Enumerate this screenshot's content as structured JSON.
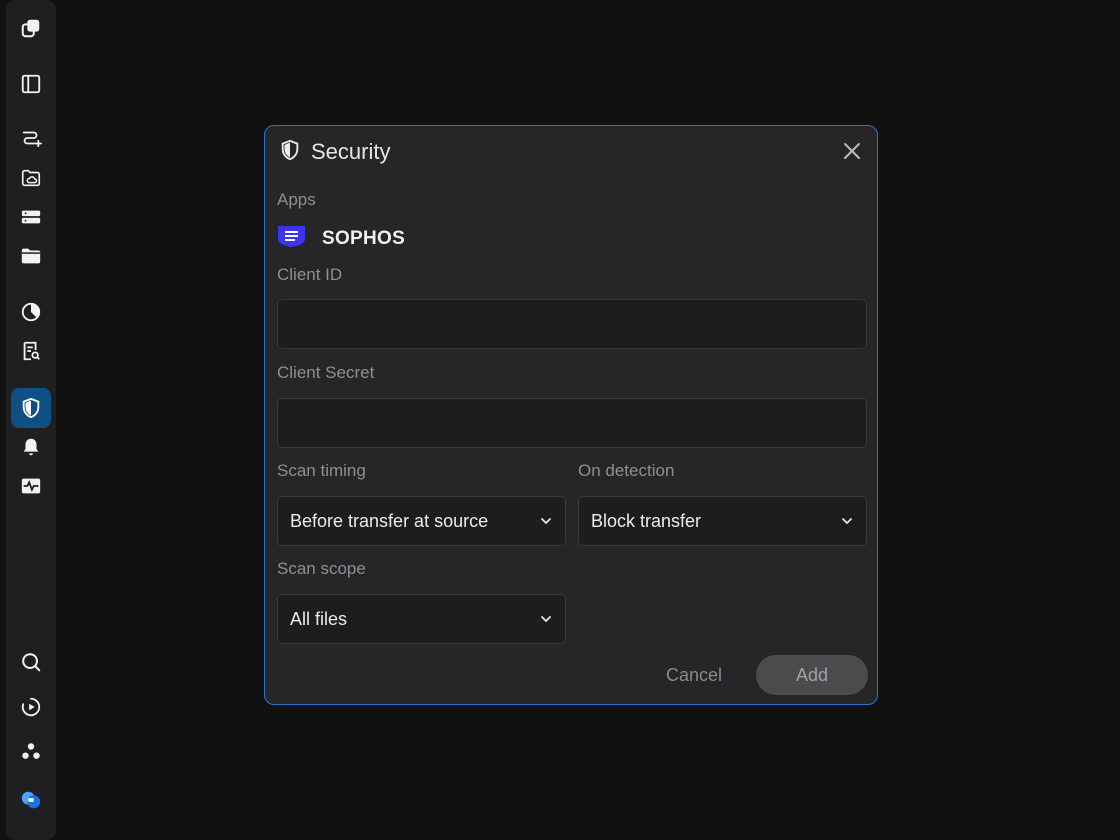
{
  "sidebar": {
    "items": [
      {
        "icon": "app-logo-icon"
      },
      {
        "icon": "panel-toggle-icon"
      },
      {
        "icon": "transfer-route-icon"
      },
      {
        "icon": "cloud-folder-icon"
      },
      {
        "icon": "storage-server-icon"
      },
      {
        "icon": "folder-icon"
      },
      {
        "icon": "analytics-pie-icon"
      },
      {
        "icon": "report-search-icon"
      },
      {
        "icon": "security-shield-icon",
        "active": true
      },
      {
        "icon": "bell-icon"
      },
      {
        "icon": "activity-monitor-icon"
      },
      {
        "icon": "search-icon"
      },
      {
        "icon": "play-circle-icon"
      },
      {
        "icon": "community-icon"
      },
      {
        "icon": "brand-logo-icon"
      }
    ],
    "accent": "#0e4f86"
  },
  "dialog": {
    "title": "Security",
    "apps_label": "Apps",
    "app_name": "SOPHOS",
    "client_id_label": "Client ID",
    "client_id_value": "",
    "client_secret_label": "Client Secret",
    "client_secret_value": "",
    "scan_timing_label": "Scan timing",
    "scan_timing_value": "Before transfer at source",
    "on_detection_label": "On detection",
    "on_detection_value": "Block transfer",
    "scan_scope_label": "Scan scope",
    "scan_scope_value": "All files",
    "cancel_label": "Cancel",
    "add_label": "Add",
    "border_color": "#2e6fd6",
    "brand_color": "#3b35f0"
  }
}
